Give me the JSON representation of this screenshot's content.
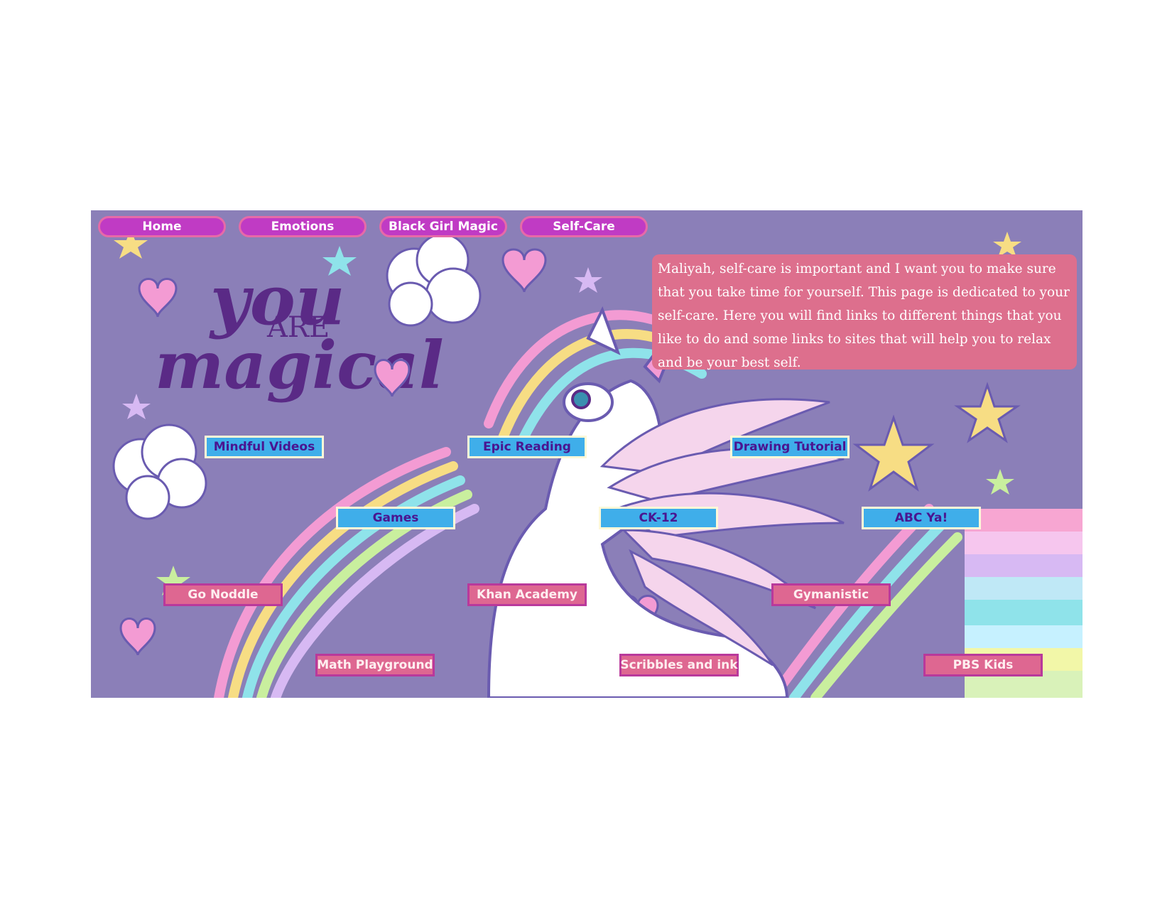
{
  "nav": {
    "items": [
      {
        "label": "Home"
      },
      {
        "label": "Emotions"
      },
      {
        "label": "Black Girl Magic"
      },
      {
        "label": "Self-Care"
      }
    ]
  },
  "hero": {
    "lettering": [
      "you",
      "ARE",
      "magical"
    ]
  },
  "message": {
    "text": "Maliyah, self-care is important and I want you to make sure that you take time for yourself. This page is dedicated to your self-care. Here you will find links to different things that you like to do and some links to sites that will help you to relax and be your best self."
  },
  "links": {
    "blue": [
      {
        "label": "Mindful Videos"
      },
      {
        "label": "Epic Reading"
      },
      {
        "label": "Drawing Tutorial"
      },
      {
        "label": "Games"
      },
      {
        "label": "CK-12"
      },
      {
        "label": "ABC Ya!"
      }
    ],
    "pink": [
      {
        "label": "Go Noddle"
      },
      {
        "label": "Khan Academy"
      },
      {
        "label": "Gymanistic"
      },
      {
        "label": "Math Playground"
      },
      {
        "label": "Scribbles and ink"
      },
      {
        "label": "PBS Kids"
      }
    ]
  },
  "colors": {
    "background": "#8b7fb8",
    "nav_pill": "#c03bc4",
    "message_box": "#dd6f8d",
    "blue_button": "#3faeea",
    "pink_button": "#de6791"
  }
}
